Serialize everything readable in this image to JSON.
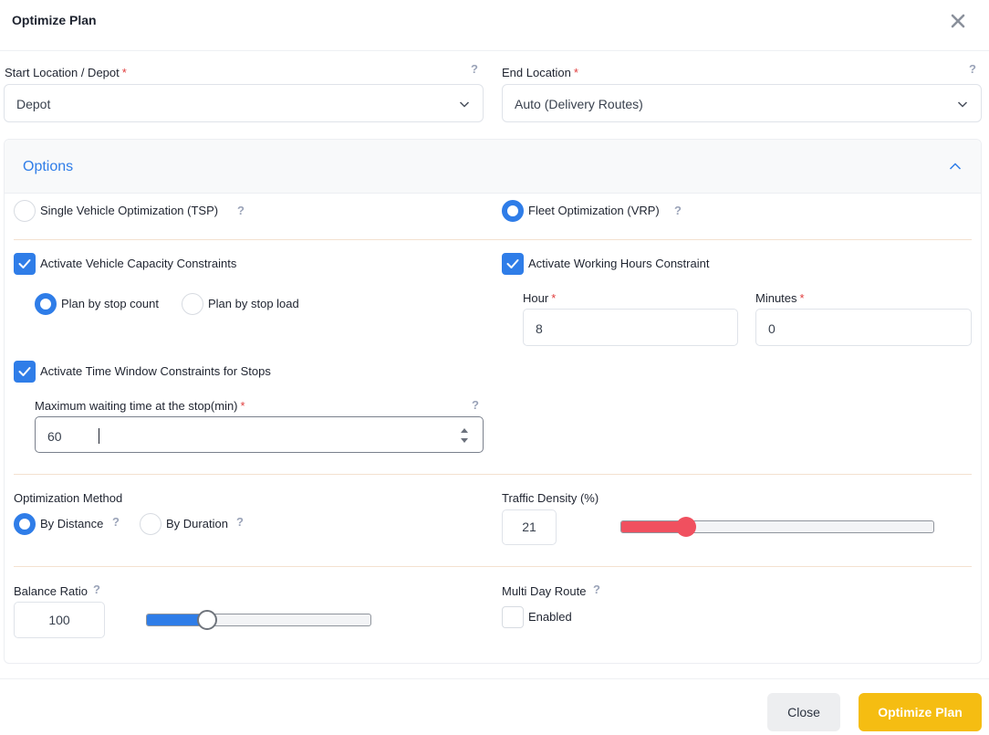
{
  "dialog": {
    "title": "Optimize Plan"
  },
  "start": {
    "label": "Start Location / Depot",
    "required": "*",
    "value": "Depot"
  },
  "end": {
    "label": "End Location",
    "required": "*",
    "value": "Auto (Delivery Routes)"
  },
  "help": "?",
  "options": {
    "title": "Options",
    "tsp_label": "Single Vehicle Optimization (TSP)",
    "vrp_label": "Fleet Optimization (VRP)",
    "capacity_label": "Activate Vehicle Capacity Constraints",
    "stop_count_label": "Plan by stop count",
    "stop_load_label": "Plan by stop load",
    "working_hours_label": "Activate Working Hours Constraint",
    "hour_label": "Hour",
    "hour_value": "8",
    "minutes_label": "Minutes",
    "minutes_value": "0",
    "time_window_label": "Activate Time Window Constraints for Stops",
    "waiting_label": "Maximum waiting time at the stop(min)",
    "waiting_value": "60",
    "method_label": "Optimization Method",
    "by_distance_label": "By Distance",
    "by_duration_label": "By Duration",
    "traffic_label": "Traffic Density (%)",
    "traffic_value": "21",
    "traffic_fraction": 0.21,
    "balance_label": "Balance Ratio",
    "balance_value": "100",
    "balance_fraction": 0.27,
    "multiday_label": "Multi Day Route",
    "enabled_label": "Enabled"
  },
  "footer": {
    "close_label": "Close",
    "optimize_label": "Optimize Plan"
  },
  "colors": {
    "accent": "#2f7de8",
    "primary_button": "#f5bd12",
    "traffic_slider": "#f0505f",
    "balance_slider": "#2f7de8",
    "required": "#e03e3e"
  }
}
